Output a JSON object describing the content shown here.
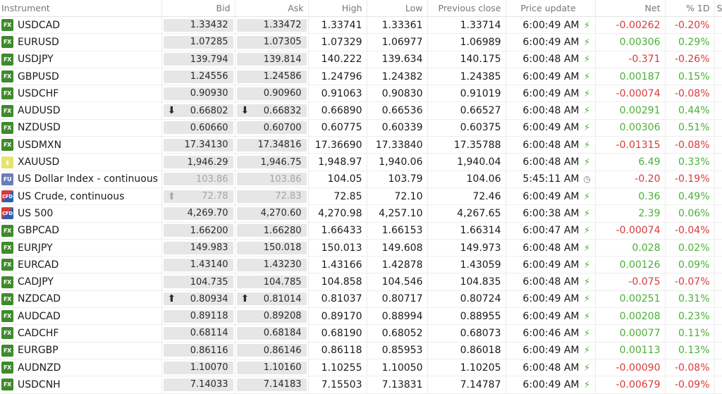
{
  "columns": {
    "instrument": "Instrument",
    "bid": "Bid",
    "ask": "Ask",
    "high": "High",
    "low": "Low",
    "prev_close": "Previous close",
    "price_update": "Price update",
    "net": "Net",
    "pct": "% 1D",
    "extra": "S"
  },
  "colors": {
    "positive": "#4caf38",
    "negative": "#d93b3b",
    "fx_badge": "#3f8a2c"
  },
  "rows": [
    {
      "badge": "FX",
      "type": "fx",
      "name": "USDCAD",
      "bid": "1.33432",
      "ask": "1.33472",
      "high": "1.33741",
      "low": "1.33361",
      "prev": "1.33714",
      "time": "6:00:49 AM",
      "status": "bolt-icon",
      "net": "-0.00262",
      "pct": "-0.20%",
      "dir": "neg"
    },
    {
      "badge": "FX",
      "type": "fx",
      "name": "EURUSD",
      "bid": "1.07285",
      "ask": "1.07305",
      "high": "1.07329",
      "low": "1.06977",
      "prev": "1.06989",
      "time": "6:00:49 AM",
      "status": "bolt-icon",
      "net": "0.00306",
      "pct": "0.29%",
      "dir": "pos"
    },
    {
      "badge": "FX",
      "type": "fx",
      "name": "USDJPY",
      "bid": "139.794",
      "ask": "139.814",
      "high": "140.222",
      "low": "139.634",
      "prev": "140.175",
      "time": "6:00:48 AM",
      "status": "bolt-icon",
      "net": "-0.371",
      "pct": "-0.26%",
      "dir": "neg"
    },
    {
      "badge": "FX",
      "type": "fx",
      "name": "GBPUSD",
      "bid": "1.24556",
      "ask": "1.24586",
      "high": "1.24796",
      "low": "1.24382",
      "prev": "1.24385",
      "time": "6:00:49 AM",
      "status": "bolt-icon",
      "net": "0.00187",
      "pct": "0.15%",
      "dir": "pos"
    },
    {
      "badge": "FX",
      "type": "fx",
      "name": "USDCHF",
      "bid": "0.90930",
      "ask": "0.90960",
      "high": "0.91063",
      "low": "0.90830",
      "prev": "0.91019",
      "time": "6:00:49 AM",
      "status": "bolt-icon",
      "net": "-0.00074",
      "pct": "-0.08%",
      "dir": "neg"
    },
    {
      "badge": "FX",
      "type": "fx",
      "name": "AUDUSD",
      "bid": "0.66802",
      "ask": "0.66832",
      "high": "0.66890",
      "low": "0.66536",
      "prev": "0.66527",
      "time": "6:00:48 AM",
      "status": "bolt-icon",
      "net": "0.00291",
      "pct": "0.44%",
      "dir": "pos",
      "arrow": "down"
    },
    {
      "badge": "FX",
      "type": "fx",
      "name": "NZDUSD",
      "bid": "0.60660",
      "ask": "0.60700",
      "high": "0.60775",
      "low": "0.60339",
      "prev": "0.60375",
      "time": "6:00:49 AM",
      "status": "bolt-icon",
      "net": "0.00306",
      "pct": "0.51%",
      "dir": "pos"
    },
    {
      "badge": "FX",
      "type": "fx",
      "name": "USDMXN",
      "bid": "17.34130",
      "ask": "17.34816",
      "high": "17.36690",
      "low": "17.33840",
      "prev": "17.35788",
      "time": "6:00:48 AM",
      "status": "bolt-icon",
      "net": "-0.01315",
      "pct": "-0.08%",
      "dir": "neg"
    },
    {
      "badge": "",
      "type": "metal",
      "name": "XAUUSD",
      "bid": "1,946.29",
      "ask": "1,946.75",
      "high": "1,948.97",
      "low": "1,940.06",
      "prev": "1,940.04",
      "time": "6:00:48 AM",
      "status": "bolt-icon",
      "net": "6.49",
      "pct": "0.33%",
      "dir": "pos"
    },
    {
      "badge": "FU",
      "type": "fu",
      "name": "US Dollar Index - continuous",
      "bid": "103.86",
      "ask": "103.86",
      "high": "104.05",
      "low": "103.79",
      "prev": "104.06",
      "time": "5:45:11 AM",
      "status": "clock-icon",
      "net": "-0.20",
      "pct": "-0.19%",
      "dir": "neg",
      "stale": true
    },
    {
      "badge": "CFD",
      "type": "cfd",
      "name": "US Crude, continuous",
      "bid": "72.78",
      "ask": "72.83",
      "high": "72.85",
      "low": "72.10",
      "prev": "72.46",
      "time": "6:00:49 AM",
      "status": "bolt-icon",
      "net": "0.36",
      "pct": "0.49%",
      "dir": "pos",
      "stale": true,
      "bid_arrow": "up-grey"
    },
    {
      "badge": "CFD",
      "type": "cfd",
      "name": "US 500",
      "bid": "4,269.70",
      "ask": "4,270.60",
      "high": "4,270.98",
      "low": "4,257.10",
      "prev": "4,267.65",
      "time": "6:00:38 AM",
      "status": "bolt-icon",
      "net": "2.39",
      "pct": "0.06%",
      "dir": "pos"
    },
    {
      "badge": "FX",
      "type": "fx",
      "name": "GBPCAD",
      "bid": "1.66200",
      "ask": "1.66280",
      "high": "1.66433",
      "low": "1.66153",
      "prev": "1.66314",
      "time": "6:00:47 AM",
      "status": "bolt-icon",
      "net": "-0.00074",
      "pct": "-0.04%",
      "dir": "neg"
    },
    {
      "badge": "FX",
      "type": "fx",
      "name": "EURJPY",
      "bid": "149.983",
      "ask": "150.018",
      "high": "150.013",
      "low": "149.608",
      "prev": "149.973",
      "time": "6:00:48 AM",
      "status": "bolt-icon",
      "net": "0.028",
      "pct": "0.02%",
      "dir": "pos"
    },
    {
      "badge": "FX",
      "type": "fx",
      "name": "EURCAD",
      "bid": "1.43140",
      "ask": "1.43230",
      "high": "1.43166",
      "low": "1.42878",
      "prev": "1.43059",
      "time": "6:00:49 AM",
      "status": "bolt-icon",
      "net": "0.00126",
      "pct": "0.09%",
      "dir": "pos"
    },
    {
      "badge": "FX",
      "type": "fx",
      "name": "CADJPY",
      "bid": "104.735",
      "ask": "104.785",
      "high": "104.858",
      "low": "104.546",
      "prev": "104.835",
      "time": "6:00:48 AM",
      "status": "bolt-icon",
      "net": "-0.075",
      "pct": "-0.07%",
      "dir": "neg"
    },
    {
      "badge": "FX",
      "type": "fx",
      "name": "NZDCAD",
      "bid": "0.80934",
      "ask": "0.81014",
      "high": "0.81037",
      "low": "0.80717",
      "prev": "0.80724",
      "time": "6:00:49 AM",
      "status": "bolt-icon",
      "net": "0.00251",
      "pct": "0.31%",
      "dir": "pos",
      "arrow": "up"
    },
    {
      "badge": "FX",
      "type": "fx",
      "name": "AUDCAD",
      "bid": "0.89118",
      "ask": "0.89208",
      "high": "0.89170",
      "low": "0.88994",
      "prev": "0.88955",
      "time": "6:00:49 AM",
      "status": "bolt-icon",
      "net": "0.00208",
      "pct": "0.23%",
      "dir": "pos"
    },
    {
      "badge": "FX",
      "type": "fx",
      "name": "CADCHF",
      "bid": "0.68114",
      "ask": "0.68184",
      "high": "0.68190",
      "low": "0.68052",
      "prev": "0.68073",
      "time": "6:00:46 AM",
      "status": "bolt-icon",
      "net": "0.00077",
      "pct": "0.11%",
      "dir": "pos"
    },
    {
      "badge": "FX",
      "type": "fx",
      "name": "EURGBP",
      "bid": "0.86116",
      "ask": "0.86146",
      "high": "0.86118",
      "low": "0.85953",
      "prev": "0.86018",
      "time": "6:00:49 AM",
      "status": "bolt-icon",
      "net": "0.00113",
      "pct": "0.13%",
      "dir": "pos"
    },
    {
      "badge": "FX",
      "type": "fx",
      "name": "AUDNZD",
      "bid": "1.10070",
      "ask": "1.10160",
      "high": "1.10255",
      "low": "1.10050",
      "prev": "1.10205",
      "time": "6:00:48 AM",
      "status": "bolt-icon",
      "net": "-0.00090",
      "pct": "-0.08%",
      "dir": "neg"
    },
    {
      "badge": "FX",
      "type": "fx",
      "name": "USDCNH",
      "bid": "7.14033",
      "ask": "7.14183",
      "high": "7.15503",
      "low": "7.13831",
      "prev": "7.14787",
      "time": "6:00:49 AM",
      "status": "bolt-icon",
      "net": "-0.00679",
      "pct": "-0.09%",
      "dir": "neg"
    }
  ]
}
